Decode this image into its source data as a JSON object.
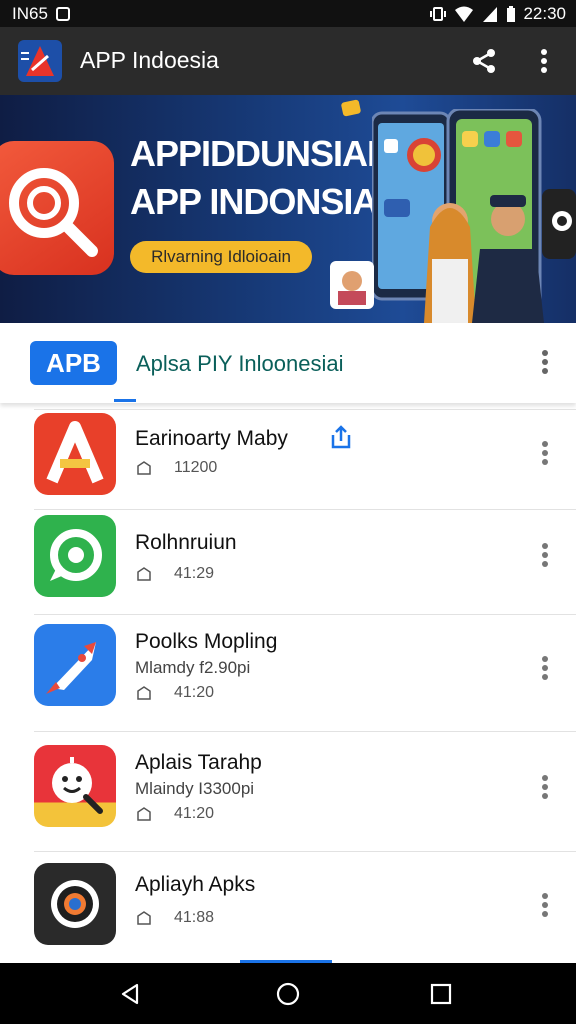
{
  "status_bar": {
    "left_text": "IN65",
    "time": "22:30"
  },
  "toolbar": {
    "title": "APP Indoesia"
  },
  "banner": {
    "headline1": "APPIDDUNSIAI",
    "headline2": "APP INDONSIA",
    "pill_text": "Rlvarning Idloioain"
  },
  "app_header": {
    "badge": "APB",
    "name": "Aplsa PIY Inloonesiai"
  },
  "apps": [
    {
      "name": "Earinoarty Maby",
      "subtitle": "",
      "meta": "11200",
      "has_share": true
    },
    {
      "name": "Rolhnruiun",
      "subtitle": "",
      "meta": "41:29",
      "has_share": false
    },
    {
      "name": "Poolks Mopling",
      "subtitle": "Mlamdy f2.90pi",
      "meta": "41:20",
      "has_share": false
    },
    {
      "name": "Aplais Tarahp",
      "subtitle": "Mlaindy I3300pi",
      "meta": "41:20",
      "has_share": false
    },
    {
      "name": "Apliayh Apks",
      "subtitle": "",
      "meta": "41:88",
      "has_share": false
    }
  ],
  "colors": {
    "toolbar_bg": "#2b2b2b",
    "accent_blue": "#1a73e8",
    "app_name_teal": "#0a5f5a",
    "pill_yellow": "#f3b92a"
  },
  "icons": [
    "app-logo-icon",
    "share-icon",
    "more-vert-icon",
    "search-magnifier-icon",
    "home-icon",
    "back-nav-icon",
    "home-nav-icon",
    "recents-nav-icon"
  ]
}
